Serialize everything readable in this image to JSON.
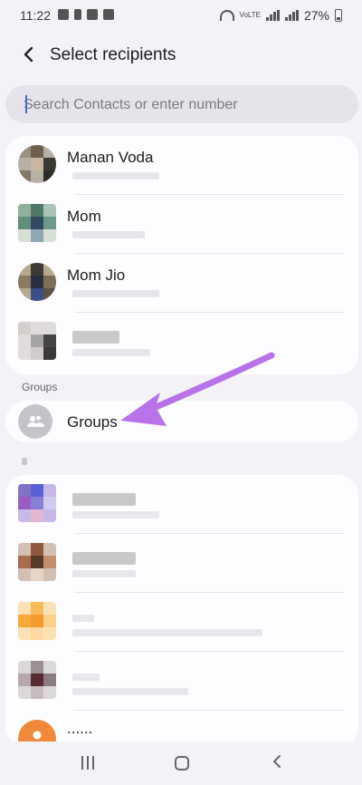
{
  "status_bar": {
    "time": "11:22",
    "battery": "27%",
    "volte": "VoLTE"
  },
  "header": {
    "title": "Select recipients"
  },
  "search": {
    "placeholder": "Search Contacts or enter number"
  },
  "contacts": [
    {
      "name": "Manan Voda"
    },
    {
      "name": "Mom"
    },
    {
      "name": "Mom Jio"
    },
    {
      "name": ""
    }
  ],
  "groups_section": {
    "label": "Groups",
    "item_label": "Groups"
  },
  "alpha_section": {
    "label": ""
  },
  "other_contacts": [
    {
      "name": ""
    },
    {
      "name": ""
    },
    {
      "name": ""
    },
    {
      "name": ""
    },
    {
      "name": "......"
    }
  ],
  "annotation": {
    "color": "#b873e8"
  },
  "colors": {
    "background": "#f4f2f6",
    "card": "#fdfcfe",
    "search": "#e6e4ea"
  }
}
